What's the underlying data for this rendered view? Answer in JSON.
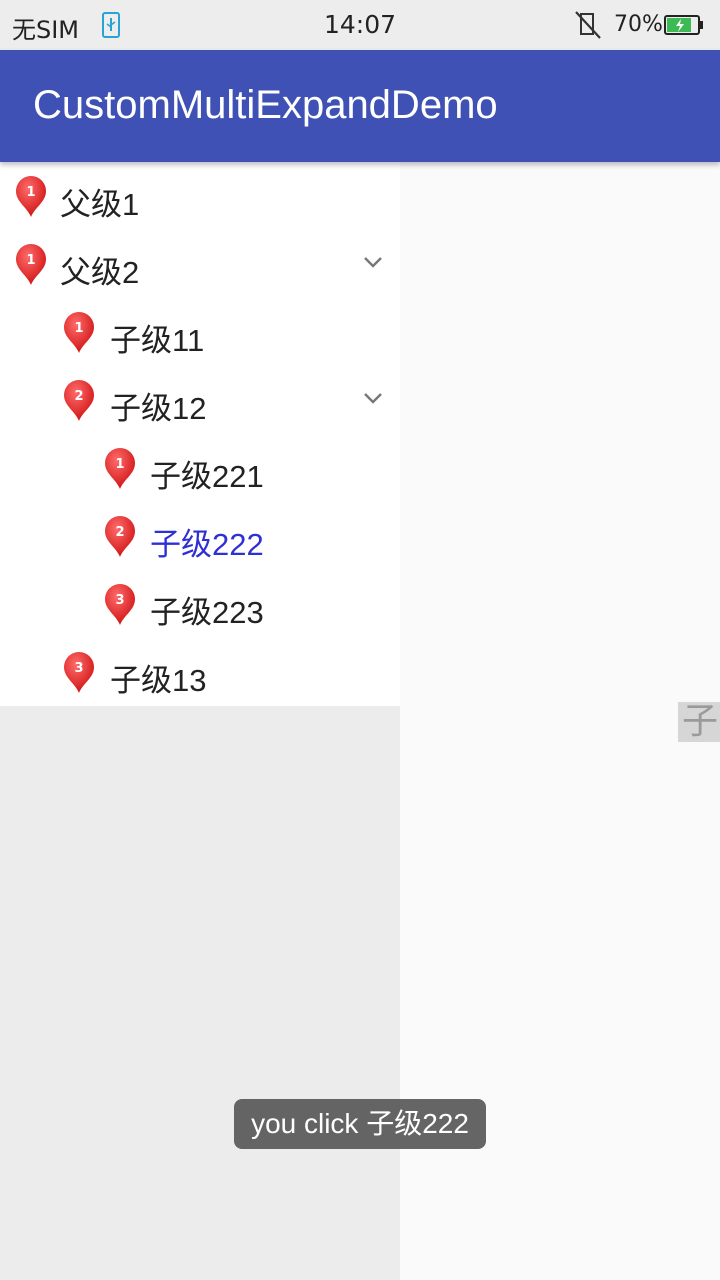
{
  "status_bar": {
    "carrier": "无SIM",
    "time": "14:07",
    "battery_percent": "70%",
    "battery_level": 0.7,
    "icons": [
      "usb-icon",
      "mute-icon",
      "battery-icon"
    ]
  },
  "app_bar": {
    "title": "CustomMultiExpandDemo",
    "color": "#3f51b5"
  },
  "tree": {
    "rows": [
      {
        "label": "父级1",
        "badge": "1",
        "level": 0,
        "expanded": false,
        "selected": false
      },
      {
        "label": "父级2",
        "badge": "1",
        "level": 0,
        "expanded": true,
        "selected": false
      },
      {
        "label": "子级11",
        "badge": "1",
        "level": 1,
        "expanded": false,
        "selected": false
      },
      {
        "label": "子级12",
        "badge": "2",
        "level": 1,
        "expanded": true,
        "selected": false
      },
      {
        "label": "子级221",
        "badge": "1",
        "level": 2,
        "expanded": false,
        "selected": false
      },
      {
        "label": "子级222",
        "badge": "2",
        "level": 2,
        "expanded": false,
        "selected": true
      },
      {
        "label": "子级223",
        "badge": "3",
        "level": 2,
        "expanded": false,
        "selected": false
      },
      {
        "label": "子级13",
        "badge": "3",
        "level": 1,
        "expanded": false,
        "selected": false
      }
    ],
    "selected_color": "#2f2fd6"
  },
  "side_index": {
    "label": "子"
  },
  "toast": {
    "message": "you click 子级222"
  }
}
